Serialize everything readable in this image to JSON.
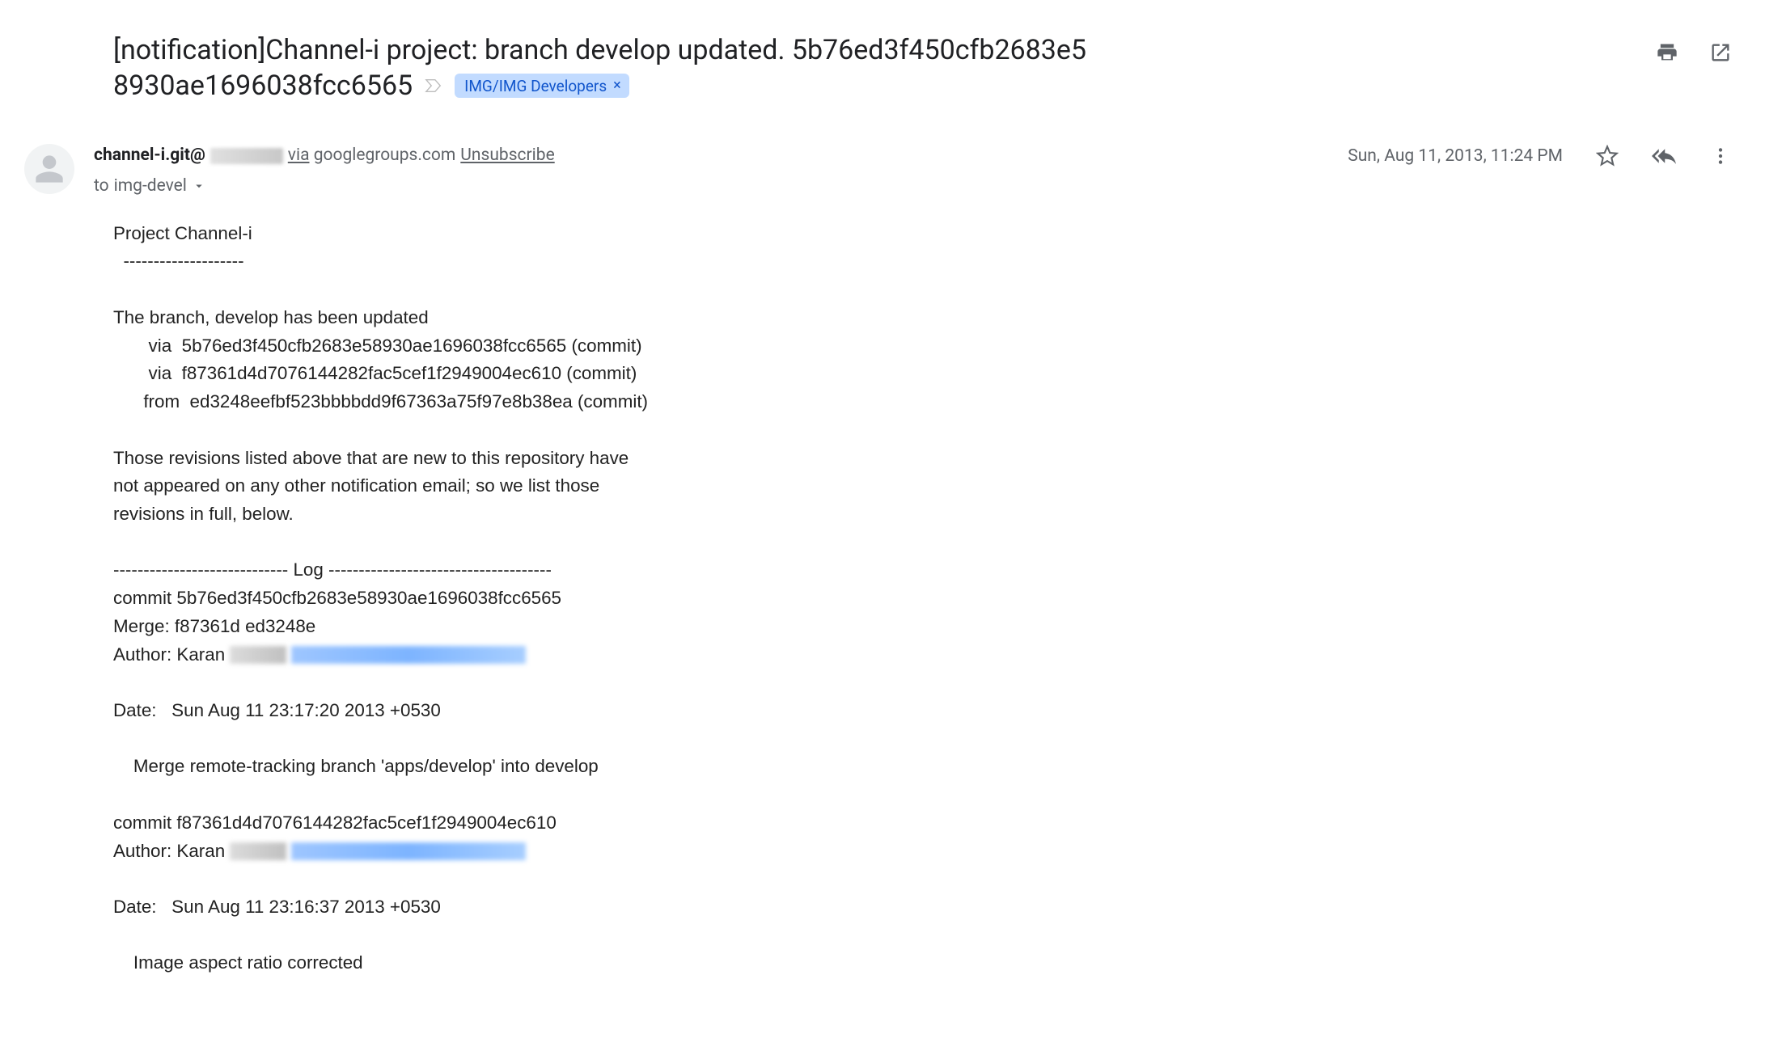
{
  "subject": {
    "line1": "[notification]Channel-i project: branch develop updated. 5b76ed3f450cfb2683e5",
    "line2": "8930ae1696038fcc6565"
  },
  "label": {
    "name": "IMG/IMG Developers",
    "remove": "×"
  },
  "sender": {
    "name": "channel-i.git@",
    "via_word": "via",
    "via_domain": " googlegroups.com ",
    "unsubscribe": "Unsubscribe"
  },
  "recipients": {
    "to_prefix": "to ",
    "to": "img-devel"
  },
  "meta": {
    "date": "Sun, Aug 11, 2013, 11:24 PM"
  },
  "body": {
    "l0": "Project Channel-i",
    "l1": "  --------------------",
    "l2": "",
    "l3": "The branch, develop has been updated",
    "l4": "       via  5b76ed3f450cfb2683e58930ae1696038fcc6565 (commit)",
    "l5": "       via  f87361d4d7076144282fac5cef1f2949004ec610 (commit)",
    "l6": "      from  ed3248eefbf523bbbbdd9f67363a75f97e8b38ea (commit)",
    "l7": "",
    "l8": "Those revisions listed above that are new to this repository have",
    "l9": "not appeared on any other notification email; so we list those",
    "l10": "revisions in full, below.",
    "l11": "",
    "l12": "----------------------------- Log -------------------------------------",
    "l13": "commit 5b76ed3f450cfb2683e58930ae1696038fcc6565",
    "l14": "Merge: f87361d ed3248e",
    "l15a": "Author: Karan ",
    "l16": "Date:   Sun Aug 11 23:17:20 2013 +0530",
    "l17": "",
    "l18": "    Merge remote-tracking branch 'apps/develop' into develop",
    "l19": "",
    "l20": "commit f87361d4d7076144282fac5cef1f2949004ec610",
    "l21a": "Author: Karan ",
    "l22": "Date:   Sun Aug 11 23:16:37 2013 +0530",
    "l23": "",
    "l24": "    Image aspect ratio corrected"
  }
}
